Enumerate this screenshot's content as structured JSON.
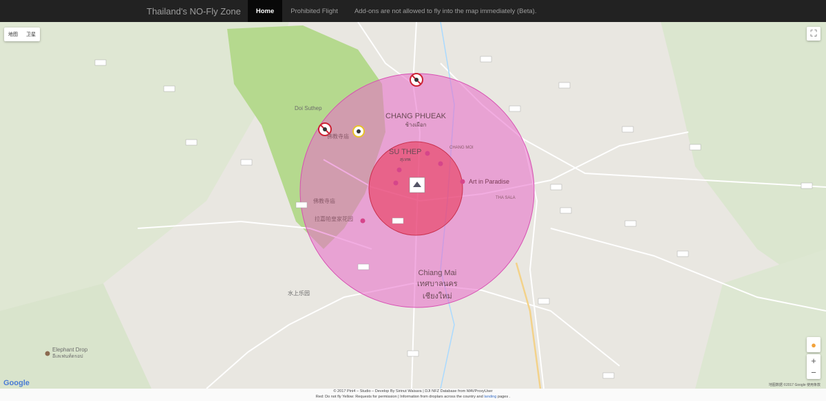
{
  "navbar": {
    "brand": "Thailand's NO-Fly Zone",
    "items": [
      {
        "label": "Home",
        "active": true
      },
      {
        "label": "Prohibited Flight",
        "active": false
      },
      {
        "label": "Add-ons are not allowed to fly into the map immediately (Beta).",
        "active": false
      }
    ]
  },
  "map": {
    "map_type": {
      "map": "地图",
      "satellite": "卫星"
    },
    "labels": {
      "chang_phueak": "CHANG PHUEAK",
      "chang_phueak_th": "ช้างเผือก",
      "su_thep": "SU THEP",
      "su_thep_th": "สุเทพ",
      "chang_moi": "CHANG MOI",
      "doi_suthep": "Doi Suthep",
      "temple1": "佛教寺庙",
      "temple2": "佛教寺庙",
      "royal_garden": "拉嘉帕皇家花园",
      "art_in_paradise": "Art in Paradise",
      "tha_sala": "THA SALA",
      "chiang_mai": "Chiang Mai",
      "chiang_mai_th1": "เทศบาลนคร",
      "chiang_mai_th2": "เชียงใหม่",
      "water_park": "水上乐园",
      "elephant_drop": "Elephant Drop",
      "elephant_drop_th": "อีเลเฟนท์ดรอป"
    },
    "google_logo": "Google",
    "terms": "地图数据 ©2017 Google 使用条款",
    "zoom_in": "+",
    "zoom_out": "−",
    "colors": {
      "outer_zone": "#e86ac8",
      "inner_zone": "#e8385a",
      "forest": "#b5d98e"
    }
  },
  "footer": {
    "line1": "© 2017 Pini4 – Studio – Develop By Sirinut Waisara | DJI NFZ Database from MAVProxyUser",
    "line2_prefix": "Red: Do not fly Yellow: Requests for permission | Information from droplars across the country and ",
    "line2_link": "landing",
    "line2_suffix": " pages ."
  }
}
